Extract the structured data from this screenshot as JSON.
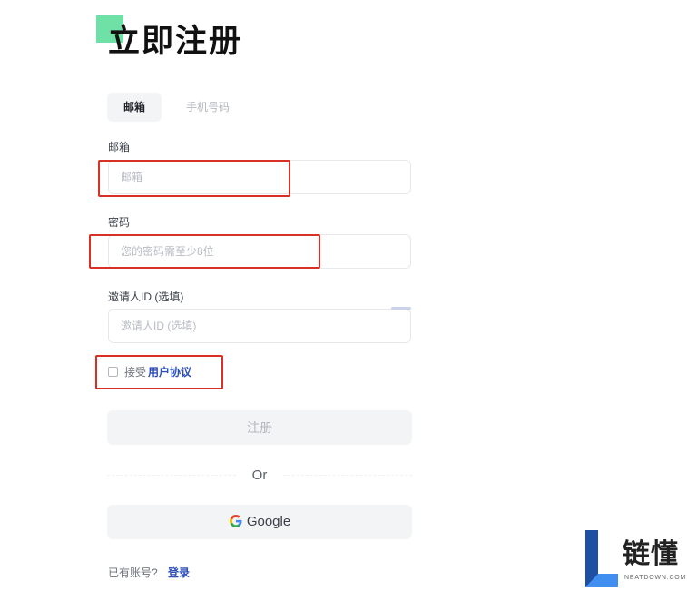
{
  "page": {
    "title": "立即注册"
  },
  "tabs": [
    {
      "label": "邮箱"
    },
    {
      "label": "手机号码"
    }
  ],
  "form": {
    "email_label": "邮箱",
    "email_placeholder": "邮箱",
    "password_label": "密码",
    "password_placeholder": "您的密码需至少8位",
    "invite_label": "邀请人ID (选填)",
    "invite_placeholder": "邀请人ID (选填)",
    "accept_text": "接受",
    "agreement_link": "用户协议",
    "register_button": "注册",
    "or_text": "Or",
    "google_button": "Google",
    "have_account_text": "已有账号?",
    "login_link": "登录"
  },
  "watermark": {
    "brand_cn": "链懂",
    "brand_en": "NEATDOWN.COM"
  },
  "colors": {
    "accent_green": "#6fe0a6",
    "link_blue": "#2c4fb8",
    "highlight_red": "#d93025"
  }
}
